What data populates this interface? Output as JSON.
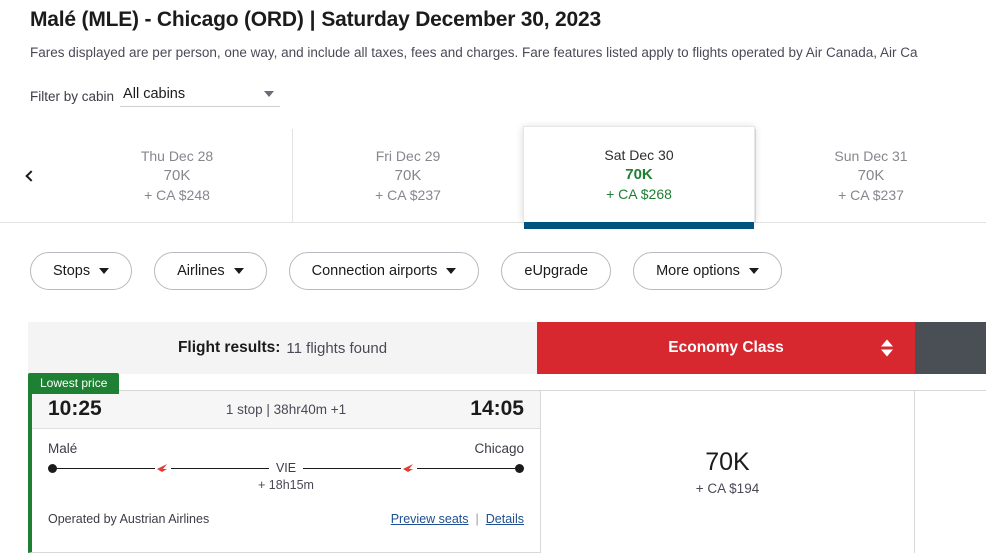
{
  "header": {
    "origin": "Malé (MLE)",
    "destination": "Chicago (ORD)",
    "title_route": "Malé (MLE) - Chicago (ORD)",
    "separator": "|",
    "date": "Saturday December 30, 2023",
    "subtitle": "Fares displayed are per person, one way, and include all taxes, fees and charges. Fare features listed apply to flights operated by Air Canada, Air Ca"
  },
  "cabin_filter": {
    "label": "Filter by cabin",
    "selected": "All cabins"
  },
  "date_carousel": {
    "prev_label": "Previous dates",
    "days": [
      {
        "day": "Thu Dec 28",
        "miles": "70K",
        "cash": "+ CA $248",
        "selected": false
      },
      {
        "day": "Fri Dec 29",
        "miles": "70K",
        "cash": "+ CA $237",
        "selected": false
      },
      {
        "day": "Sat Dec 30",
        "miles": "70K",
        "cash": "+ CA $268",
        "selected": true
      },
      {
        "day": "Sun Dec 31",
        "miles": "70K",
        "cash": "+ CA $237",
        "selected": false
      }
    ]
  },
  "filters": [
    {
      "label": "Stops",
      "caret": true
    },
    {
      "label": "Airlines",
      "caret": true
    },
    {
      "label": "Connection airports",
      "caret": true
    },
    {
      "label": "eUpgrade",
      "caret": false
    },
    {
      "label": "More options",
      "caret": true
    }
  ],
  "results_bar": {
    "results_label": "Flight results:",
    "results_count": "11 flights found",
    "cabin_column": "Economy Class"
  },
  "flights": [
    {
      "badge": "Lowest price",
      "depart_time": "10:25",
      "arrive_time": "14:05",
      "summary": "1 stop | 38hr40m +1",
      "origin_city": "Malé",
      "destination_city": "Chicago",
      "connection": "VIE",
      "layover": "+ 18h15m",
      "operated_by": "Operated by Austrian Airlines",
      "preview_seats": "Preview seats",
      "links_separator": "|",
      "details": "Details",
      "price_miles": "70K",
      "price_cash": "+ CA $194"
    }
  ],
  "colors": {
    "brand_red": "#d7282f",
    "accent_green": "#1e8033",
    "selected_underline": "#00537d",
    "link_blue": "#1d4f91",
    "dark_panel": "#4a4f55"
  }
}
